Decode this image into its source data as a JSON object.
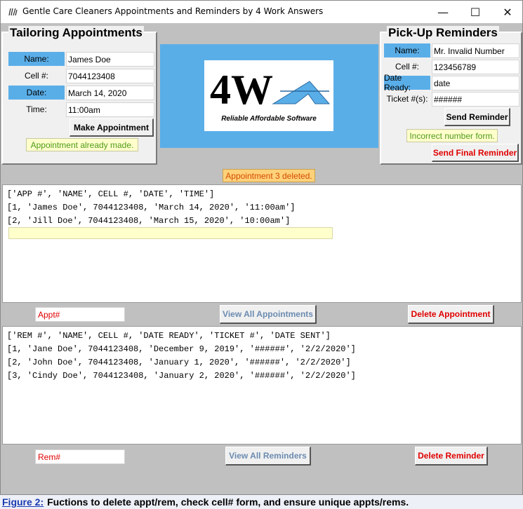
{
  "window": {
    "title": "Gentle Care Cleaners Appointments and Reminders by 4 Work Answers",
    "minimize": "—",
    "maximize": "☐",
    "close": "✕"
  },
  "tailoring": {
    "title": "Tailoring Appointments",
    "labels": {
      "name": "Name:",
      "cell": "Cell #:",
      "date": "Date:",
      "time": "Time:"
    },
    "values": {
      "name": "James Doe",
      "cell": "7044123408",
      "date": "March 14, 2020",
      "time": "11:00am"
    },
    "make_button": "Make Appointment",
    "status": "Appointment already made."
  },
  "logo": {
    "text": "4W",
    "tagline": "Reliable Affordable Software"
  },
  "pickup": {
    "title": "Pick-Up Reminders",
    "labels": {
      "name": "Name:",
      "cell": "Cell #:",
      "date_ready": "Date Ready:",
      "ticket": "Ticket #(s):"
    },
    "values": {
      "name": "Mr. Invalid Number",
      "cell": "123456789",
      "date_ready": "date",
      "ticket": "######"
    },
    "send_button": "Send Reminder",
    "status": "Incorrect number form.",
    "final_button": "Send Final Reminder"
  },
  "appointments": {
    "status": "Appointment 3 deleted.",
    "lines": [
      "['APP #', 'NAME', CELL #, 'DATE', 'TIME']",
      "[1, 'James Doe', 7044123408, 'March 14, 2020', '11:00am']",
      "[2, 'Jill Doe', 7044123408, 'March 15, 2020', '10:00am']"
    ],
    "entry_placeholder": "Appt#",
    "view_button": "View All Appointments",
    "delete_button": "Delete Appointment"
  },
  "reminders": {
    "lines": [
      "['REM #', 'NAME', CELL #, 'DATE READY', 'TICKET #', 'DATE SENT']",
      "[1, 'Jane Doe', 7044123408, 'December 9, 2019', '######', '2/2/2020']",
      "[2, 'John Doe', 7044123408, 'January 1, 2020', '######', '2/2/2020']",
      "[3, 'Cindy Doe', 7044123408, 'January 2, 2020', '######', '2/2/2020']"
    ],
    "entry_placeholder": "Rem#",
    "view_button": "View All Reminders",
    "delete_button": "Delete Reminder"
  },
  "caption": {
    "label": "Figure 2:",
    "text": "Fuctions to delete appt/rem, check cell# form, and ensure unique appts/rems."
  },
  "colors": {
    "label_blue": "#5aaee8",
    "button_red": "#e00000",
    "button_steel": "#6b8bb0",
    "status_green": "#4f9a1a",
    "status_orange": "#d44a00"
  }
}
